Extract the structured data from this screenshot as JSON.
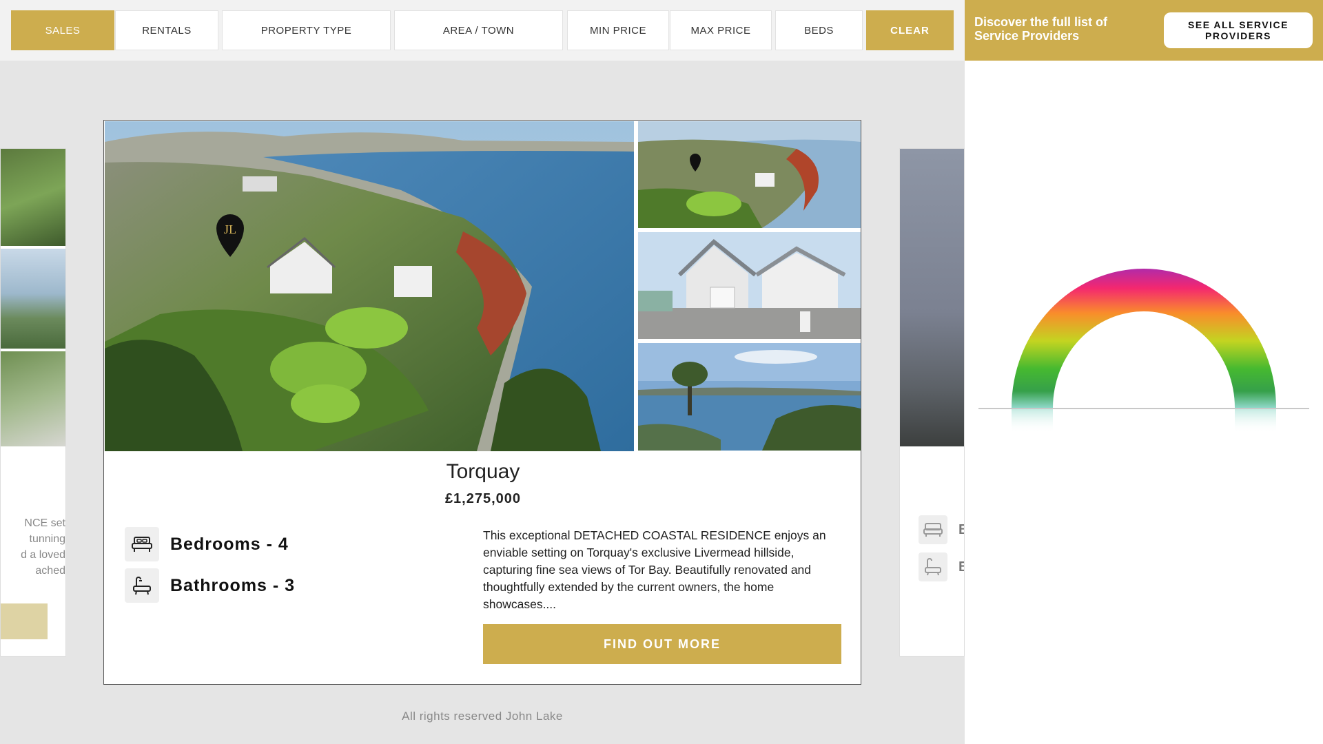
{
  "filters": {
    "items": [
      {
        "label": "SALES",
        "active": true
      },
      {
        "label": "RENTALS"
      },
      {
        "label": "PROPERTY TYPE"
      },
      {
        "label": "AREA / TOWN"
      },
      {
        "label": "MIN PRICE"
      },
      {
        "label": "MAX PRICE"
      },
      {
        "label": "BEDS"
      }
    ],
    "clear_label": "CLEAR"
  },
  "banner": {
    "text": "Discover the full list of Service Providers",
    "button_label": "SEE ALL SERVICE PROVIDERS"
  },
  "listing": {
    "location": "Torquay",
    "price": "£1,275,000",
    "bedrooms_label": "Bedrooms - 4",
    "bathrooms_label": "Bathrooms - 3",
    "description": "This exceptional DETACHED COASTAL RESIDENCE enjoys an enviable setting on Torquay's exclusive Livermead hillside, capturing fine sea views of Tor Bay. Beautifully renovated and thoughtfully extended by the current owners, the home showcases....",
    "cta_label": "FIND OUT MORE",
    "logo_text": "JL"
  },
  "ghost_left": {
    "lines": [
      "NCE set",
      "tunning",
      "d a loved",
      "ached"
    ]
  },
  "ghost_right": {
    "letter1": "B",
    "letter2": "B"
  },
  "footer": {
    "text": "All rights reserved John Lake"
  },
  "colors": {
    "accent": "#cdad4e",
    "bg": "#e5e5e5"
  }
}
